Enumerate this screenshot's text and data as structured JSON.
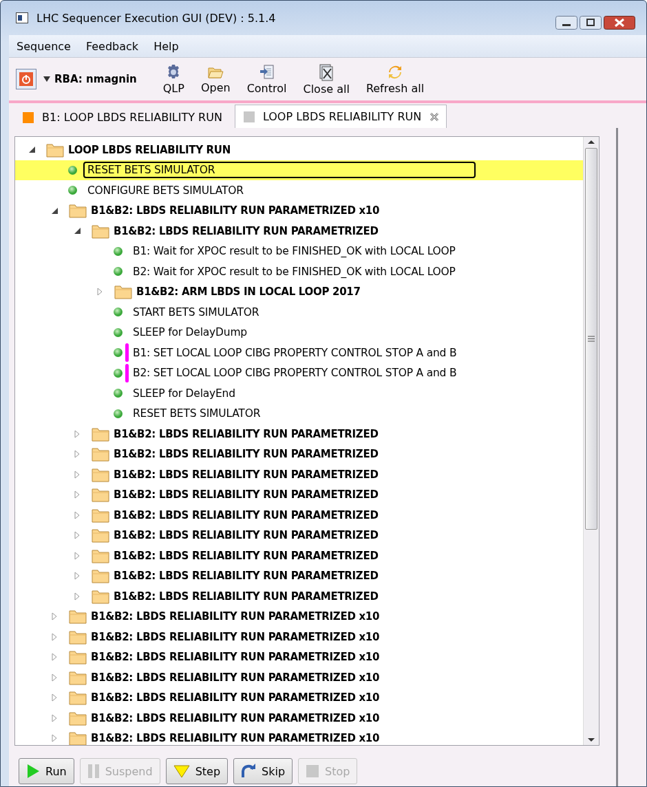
{
  "window": {
    "title": "LHC Sequencer Execution GUI (DEV) : 5.1.4"
  },
  "menu": [
    "Sequence",
    "Feedback",
    "Help"
  ],
  "toolbar": {
    "user": "RBA: nmagnin",
    "buttons": [
      {
        "kind": "gear",
        "label": "QLP"
      },
      {
        "kind": "open",
        "label": "Open"
      },
      {
        "kind": "control",
        "label": "Control"
      },
      {
        "kind": "closeall",
        "label": "Close all"
      },
      {
        "kind": "refresh",
        "label": "Refresh all"
      }
    ]
  },
  "tabs": [
    {
      "label": "B1: LOOP LBDS RELIABILITY RUN",
      "selected": false,
      "color": "#ff8c00"
    },
    {
      "label": "LOOP LBDS RELIABILITY RUN",
      "selected": true,
      "color": "#c8c8c8"
    }
  ],
  "tree": [
    {
      "kind": "folder",
      "label": "LOOP LBDS RELIABILITY RUN",
      "expanded": true,
      "children": [
        {
          "kind": "step",
          "label": "RESET BETS SIMULATOR",
          "selected": true,
          "marked": false
        },
        {
          "kind": "step",
          "label": "CONFIGURE BETS SIMULATOR",
          "selected": false,
          "marked": false
        },
        {
          "kind": "folder",
          "label": "B1&B2: LBDS RELIABILITY RUN PARAMETRIZED x10",
          "expanded": true,
          "children": [
            {
              "kind": "folder",
              "label": "B1&B2: LBDS RELIABILITY RUN PARAMETRIZED",
              "expanded": true,
              "children": [
                {
                  "kind": "step",
                  "label": "B1: Wait for XPOC result to be FINISHED_OK with LOCAL LOOP",
                  "selected": false,
                  "marked": false
                },
                {
                  "kind": "step",
                  "label": "B2: Wait for XPOC result to be FINISHED_OK with LOCAL LOOP",
                  "selected": false,
                  "marked": false
                },
                {
                  "kind": "folder",
                  "label": "B1&B2: ARM LBDS IN LOCAL LOOP 2017",
                  "expanded": false
                },
                {
                  "kind": "step",
                  "label": "START BETS SIMULATOR",
                  "selected": false,
                  "marked": false
                },
                {
                  "kind": "step",
                  "label": "SLEEP for DelayDump",
                  "selected": false,
                  "marked": false
                },
                {
                  "kind": "step",
                  "label": "B1: SET LOCAL LOOP CIBG PROPERTY CONTROL STOP A and B",
                  "selected": false,
                  "marked": true
                },
                {
                  "kind": "step",
                  "label": "B2: SET LOCAL LOOP CIBG PROPERTY CONTROL STOP A and B",
                  "selected": false,
                  "marked": true
                },
                {
                  "kind": "step",
                  "label": "SLEEP for DelayEnd",
                  "selected": false,
                  "marked": false
                },
                {
                  "kind": "step",
                  "label": "RESET BETS SIMULATOR",
                  "selected": false,
                  "marked": false
                }
              ]
            },
            {
              "kind": "folder",
              "label": "B1&B2: LBDS RELIABILITY RUN PARAMETRIZED",
              "expanded": false
            },
            {
              "kind": "folder",
              "label": "B1&B2: LBDS RELIABILITY RUN PARAMETRIZED",
              "expanded": false
            },
            {
              "kind": "folder",
              "label": "B1&B2: LBDS RELIABILITY RUN PARAMETRIZED",
              "expanded": false
            },
            {
              "kind": "folder",
              "label": "B1&B2: LBDS RELIABILITY RUN PARAMETRIZED",
              "expanded": false
            },
            {
              "kind": "folder",
              "label": "B1&B2: LBDS RELIABILITY RUN PARAMETRIZED",
              "expanded": false
            },
            {
              "kind": "folder",
              "label": "B1&B2: LBDS RELIABILITY RUN PARAMETRIZED",
              "expanded": false
            },
            {
              "kind": "folder",
              "label": "B1&B2: LBDS RELIABILITY RUN PARAMETRIZED",
              "expanded": false
            },
            {
              "kind": "folder",
              "label": "B1&B2: LBDS RELIABILITY RUN PARAMETRIZED",
              "expanded": false
            },
            {
              "kind": "folder",
              "label": "B1&B2: LBDS RELIABILITY RUN PARAMETRIZED",
              "expanded": false
            }
          ]
        },
        {
          "kind": "folder",
          "label": "B1&B2: LBDS RELIABILITY RUN PARAMETRIZED x10",
          "expanded": false
        },
        {
          "kind": "folder",
          "label": "B1&B2: LBDS RELIABILITY RUN PARAMETRIZED x10",
          "expanded": false
        },
        {
          "kind": "folder",
          "label": "B1&B2: LBDS RELIABILITY RUN PARAMETRIZED x10",
          "expanded": false
        },
        {
          "kind": "folder",
          "label": "B1&B2: LBDS RELIABILITY RUN PARAMETRIZED x10",
          "expanded": false
        },
        {
          "kind": "folder",
          "label": "B1&B2: LBDS RELIABILITY RUN PARAMETRIZED x10",
          "expanded": false
        },
        {
          "kind": "folder",
          "label": "B1&B2: LBDS RELIABILITY RUN PARAMETRIZED x10",
          "expanded": false
        },
        {
          "kind": "folder",
          "label": "B1&B2: LBDS RELIABILITY RUN PARAMETRIZED x10",
          "expanded": false
        }
      ]
    }
  ],
  "buttons": [
    {
      "kind": "run",
      "label": "Run",
      "disabled": false
    },
    {
      "kind": "suspend",
      "label": "Suspend",
      "disabled": true
    },
    {
      "kind": "step",
      "label": "Step",
      "disabled": false
    },
    {
      "kind": "skip",
      "label": "Skip",
      "disabled": false
    },
    {
      "kind": "stop",
      "label": "Stop",
      "disabled": true
    }
  ]
}
